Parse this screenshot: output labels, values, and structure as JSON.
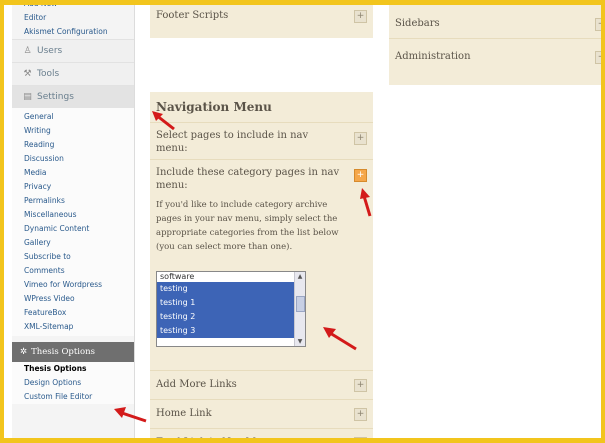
{
  "sidebar": {
    "top_items": [
      "Add New",
      "Editor",
      "Akismet Configuration"
    ],
    "users_label": "Users",
    "tools_label": "Tools",
    "settings_label": "Settings",
    "settings_items": [
      "General",
      "Writing",
      "Reading",
      "Discussion",
      "Media",
      "Privacy",
      "Permalinks",
      "Miscellaneous",
      "Dynamic Content",
      "Gallery",
      "Subscribe to",
      "Comments",
      "Vimeo for Wordpress",
      "WPress Video",
      "FeatureBox",
      "XML-Sitemap"
    ],
    "thesis_label": "Thesis Options",
    "thesis_items": [
      "Thesis Options",
      "Design Options",
      "Custom File Editor"
    ]
  },
  "mid": {
    "footer_scripts": "Footer Scripts",
    "nav_menu_title": "Navigation Menu",
    "select_pages_line1": "Select pages to include in nav",
    "select_pages_line2": "menu:",
    "include_cat_line1": "Include these category pages in nav",
    "include_cat_line2": "menu:",
    "desc_lines": [
      "If you'd like to include category archive",
      "pages in your nav menu, simply select the",
      "appropriate categories from the list below",
      "(you can select more than one)."
    ],
    "list_items": [
      "software",
      "testing",
      "testing 1",
      "testing 2",
      "testing 3"
    ],
    "add_more_links": "Add More Links",
    "home_link": "Home Link",
    "feed_link": "Feed Link in Nav Menu"
  },
  "right": {
    "sidebars": "Sidebars",
    "administration": "Administration"
  },
  "buttons": {
    "plus": "+"
  },
  "colors": {
    "frame": "#f2c51d",
    "panel": "#f3ecd8",
    "selected": "#3d64b6",
    "arrow": "#d31a1a"
  }
}
